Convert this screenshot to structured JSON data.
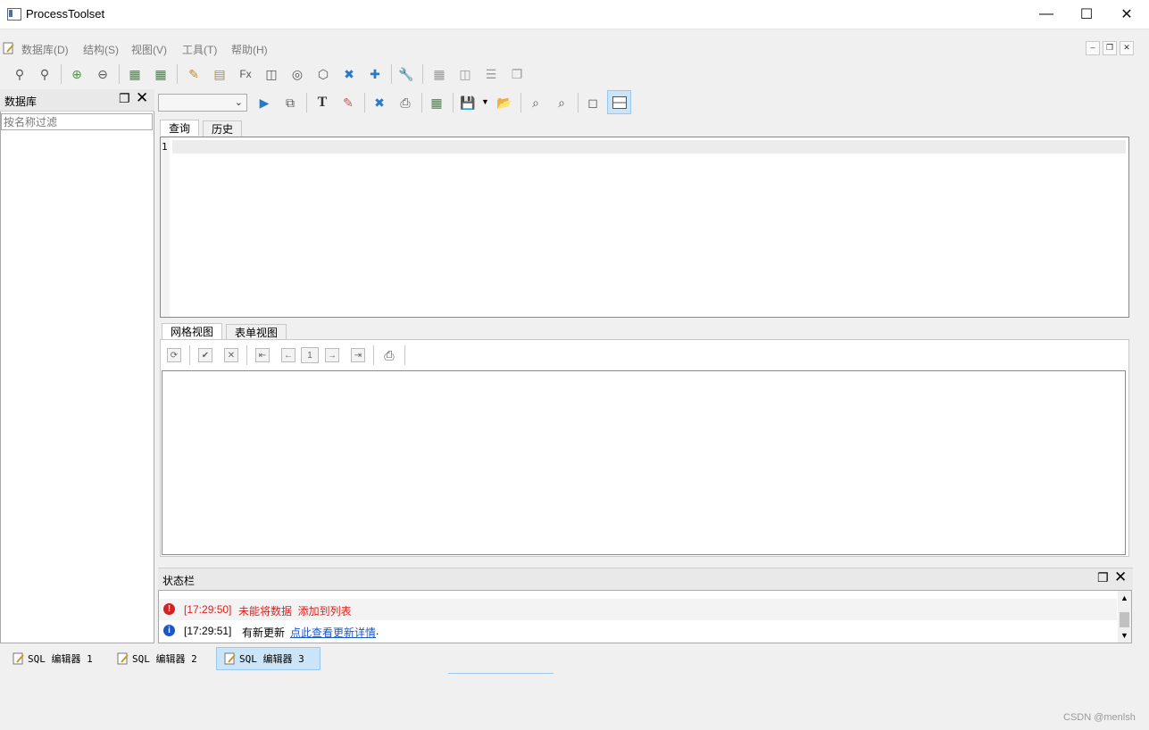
{
  "window": {
    "title": "ProcessToolset"
  },
  "menu": [
    "数据库(D)",
    "结构(S)",
    "视图(V)",
    "工具(T)",
    "帮助(H)"
  ],
  "dock_left": {
    "title": "数据库",
    "filter_placeholder": "按名称过滤"
  },
  "query_tabs": [
    "查询",
    "历史"
  ],
  "editor": {
    "line_number": "1"
  },
  "result_tabs": [
    "网格视图",
    "表单视图"
  ],
  "pager": {
    "page": "1"
  },
  "status_dock": {
    "title": "状态栏",
    "messages": [
      {
        "type": "error",
        "time": "[17:29:50]",
        "text": "未能将数据  添加到列表",
        "color": "#e0201c"
      },
      {
        "type": "info",
        "time": "[17:29:51]",
        "text": "有新更新",
        "link": "点此查看更新详情",
        "suffix": ".",
        "color": "#1a56c8"
      }
    ]
  },
  "doc_tabs": [
    "SQL 编辑器 1",
    "SQL 编辑器 2",
    "SQL 编辑器 3"
  ],
  "watermark": "CSDN @menlsh"
}
